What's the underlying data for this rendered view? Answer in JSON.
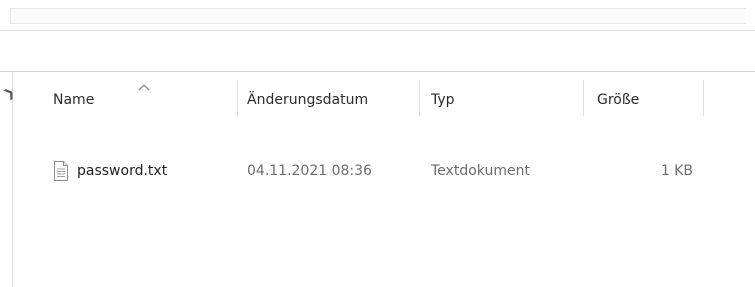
{
  "columns": {
    "name": "Name",
    "modified": "Änderungsdatum",
    "type": "Typ",
    "size": "Größe"
  },
  "sort": {
    "column": "name",
    "icon": "chevron-up-icon"
  },
  "files": [
    {
      "name": "password.txt",
      "modified": "04.11.2021 08:36",
      "type": "Textdokument",
      "size": "1 KB",
      "icon": "text-file-icon"
    }
  ],
  "colors": {
    "text": "#2b2b2b",
    "secondary_text": "#6d6d6d",
    "separator": "#e2e2e2"
  }
}
